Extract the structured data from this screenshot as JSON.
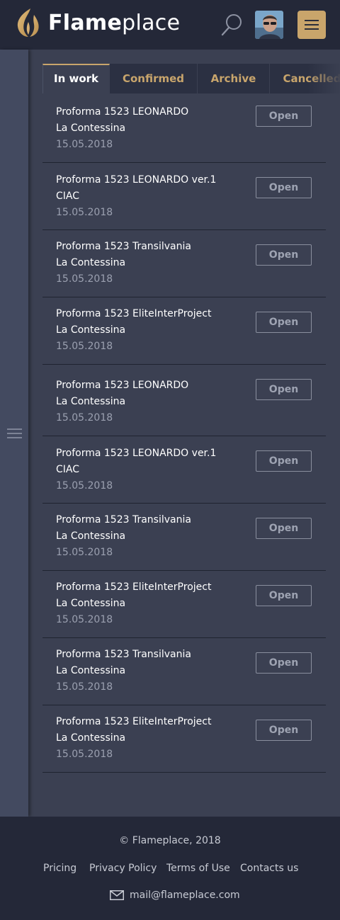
{
  "header": {
    "brand_bold": "Flame",
    "brand_light": "place",
    "colors": {
      "bar": "#242838",
      "accent": "#c9a56b"
    },
    "icons": {
      "logo": "flame-icon",
      "search": "search-icon",
      "menu": "hamburger-icon"
    }
  },
  "sidebar": {
    "icon": "hamburger-icon"
  },
  "tabs": [
    {
      "label": "In work",
      "active": true
    },
    {
      "label": "Confirmed",
      "active": false
    },
    {
      "label": "Archive",
      "active": false
    },
    {
      "label": "Cancelled",
      "active": false
    }
  ],
  "list": {
    "button_label": "Open",
    "items": [
      {
        "title": "Proforma 1523 LEONARDO",
        "subtitle": "La Contessina",
        "date": "15.05.2018"
      },
      {
        "title": "Proforma 1523 LEONARDO ver.1",
        "subtitle": "CIAC",
        "date": "15.05.2018"
      },
      {
        "title": "Proforma 1523 Transilvania",
        "subtitle": "La Contessina",
        "date": "15.05.2018"
      },
      {
        "title": "Proforma 1523 EliteInterProject",
        "subtitle": "La Contessina",
        "date": "15.05.2018"
      },
      {
        "title": "Proforma 1523 LEONARDO",
        "subtitle": "La Contessina",
        "date": "15.05.2018"
      },
      {
        "title": "Proforma 1523 LEONARDO ver.1",
        "subtitle": "CIAC",
        "date": "15.05.2018"
      },
      {
        "title": "Proforma 1523 Transilvania",
        "subtitle": "La Contessina",
        "date": "15.05.2018"
      },
      {
        "title": "Proforma 1523 EliteInterProject",
        "subtitle": "La Contessina",
        "date": "15.05.2018"
      },
      {
        "title": "Proforma 1523 Transilvania",
        "subtitle": "La Contessina",
        "date": "15.05.2018"
      },
      {
        "title": "Proforma 1523 EliteInterProject",
        "subtitle": "La Contessina",
        "date": "15.05.2018"
      }
    ]
  },
  "footer": {
    "copyright": "© Flameplace, 2018",
    "links": [
      "Pricing",
      "Privacy Policy",
      "Terms of Use",
      "Contacts us"
    ],
    "email": "mail@flameplace.com",
    "email_icon": "mail-icon"
  }
}
